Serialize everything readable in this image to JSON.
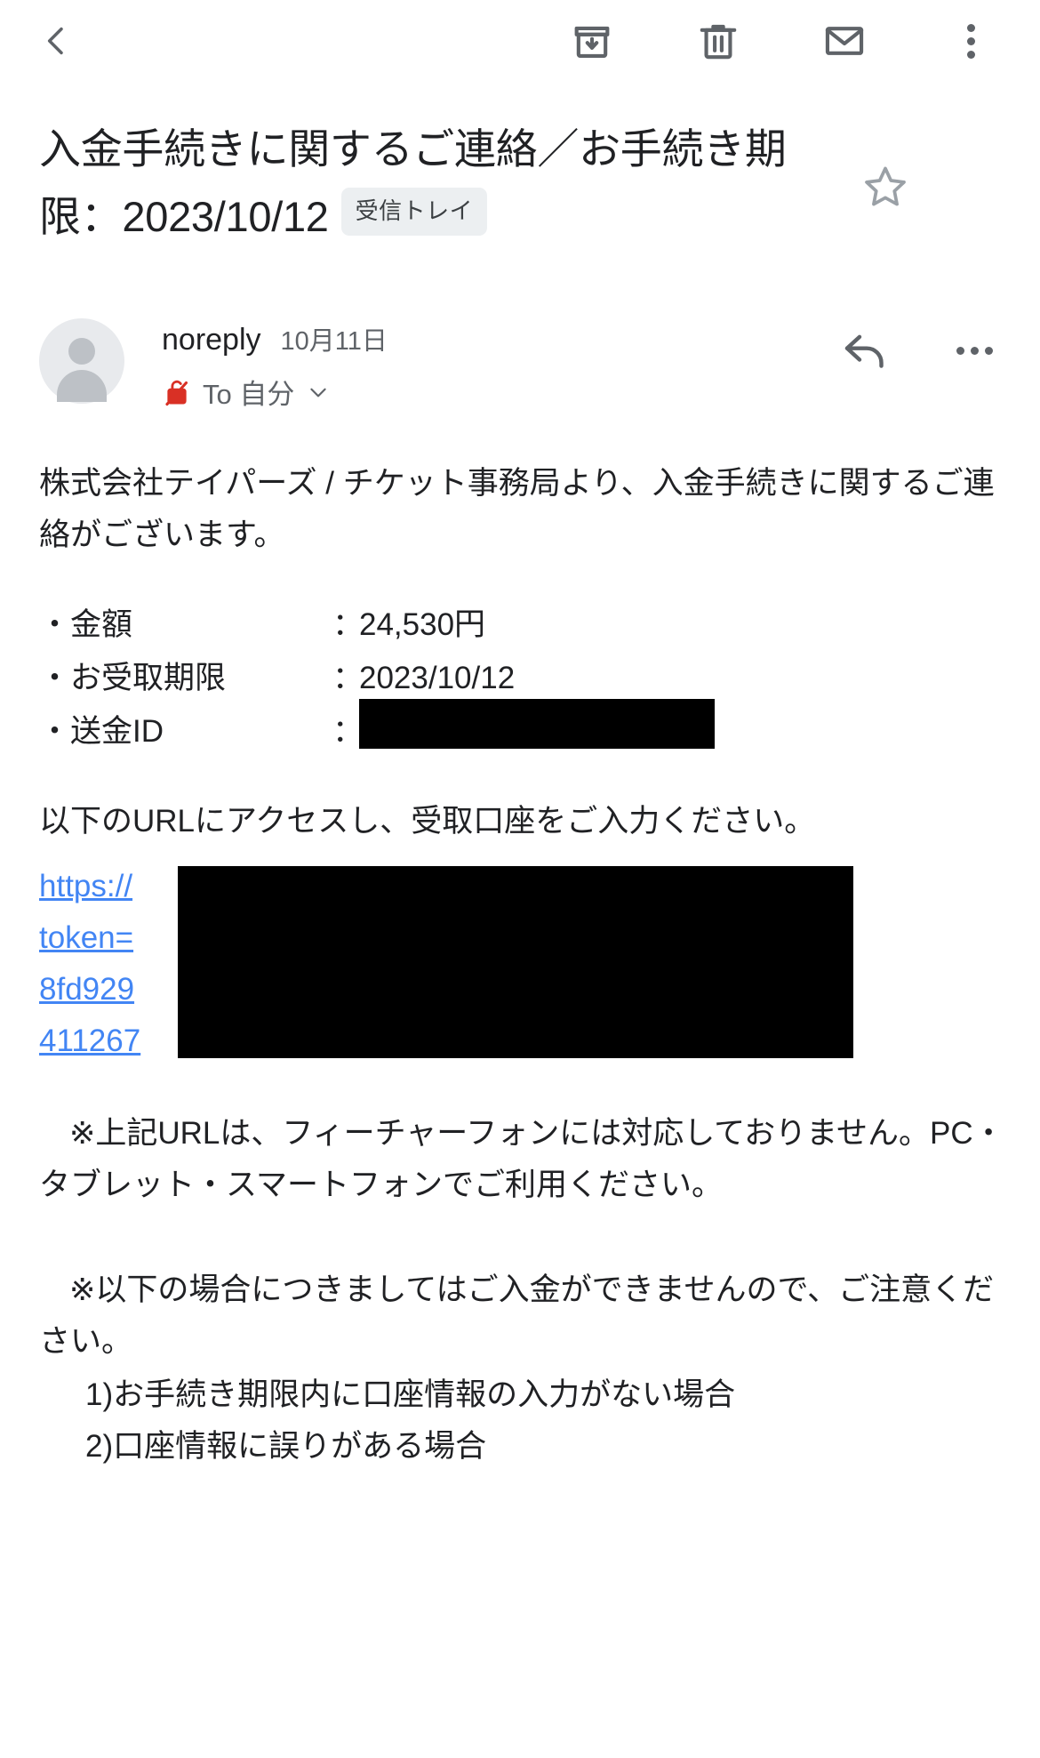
{
  "toolbar": {
    "back_label": "back-navigation",
    "archive_label": "archive",
    "delete_label": "delete",
    "unread_label": "mark-as-unread",
    "more_label": "more-options"
  },
  "subject": {
    "text": "入金手続きに関するご連絡／お手続き期限：2023/10/12",
    "label_chip": "受信トレイ",
    "star_label": "star-message"
  },
  "sender": {
    "name": "noreply",
    "date": "10月11日",
    "to": "To 自分",
    "lock_label": "no-encryption",
    "reply_label": "reply",
    "more_label": "message-more-options"
  },
  "message": {
    "intro": "株式会社テイパーズ / チケット事務局より、入金手続きに関するご連絡がございます。",
    "details": [
      {
        "key": "・金額",
        "sep": "：",
        "value": "24,530円",
        "redacted": false
      },
      {
        "key": "・お受取期限",
        "sep": "：",
        "value": "2023/10/12",
        "redacted": false
      },
      {
        "key": "・送金ID",
        "sep": "：",
        "value": "",
        "redacted": true
      }
    ],
    "url_intro": "以下のURLにアクセスし、受取口座をご入力ください。",
    "link_lines": [
      "https://",
      "token=",
      "8fd929",
      "411267"
    ],
    "note1": "※上記URLは、フィーチャーフォンには対応しておりません。PC・タブレット・スマートフォンでご利用ください。",
    "note2": "※以下の場合につきましてはご入金ができませんので、ご注意ください。",
    "conditions": [
      "1)お手続き期限内に口座情報の入力がない場合",
      "2)口座情報に誤りがある場合"
    ]
  },
  "colors": {
    "link": "#4285f4",
    "icon": "#5f6368",
    "chip_bg": "#eceff1",
    "text": "#202124",
    "lock_red": "#d93025",
    "redaction": "#000000"
  }
}
